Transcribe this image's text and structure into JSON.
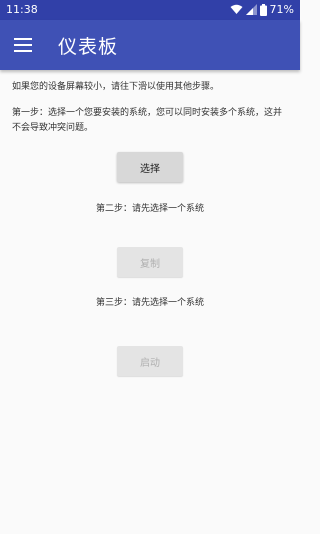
{
  "status_bar": {
    "time": "11:38",
    "battery": "71%",
    "icons": [
      "wifi-icon",
      "signal-icon",
      "battery-icon"
    ]
  },
  "toolbar": {
    "menu_icon": "menu-icon",
    "title": "仪表板"
  },
  "main": {
    "hint": "如果您的设备屏幕较小，请往下滑以使用其他步骤。",
    "step1": "第一步：选择一个您要安装的系统，您可以同时安装多个系统，这并不会导致冲突问题。",
    "select_label": "选择",
    "step2": "第二步：请先选择一个系统",
    "copy_label": "复制",
    "step3": "第三步：请先选择一个系统",
    "launch_label": "启动"
  },
  "colors": {
    "status_bar": "#3140a8",
    "toolbar": "#3f51b5",
    "background": "#fafafa",
    "button_enabled": "#d8d8d8",
    "button_disabled": "#e4e4e4"
  }
}
